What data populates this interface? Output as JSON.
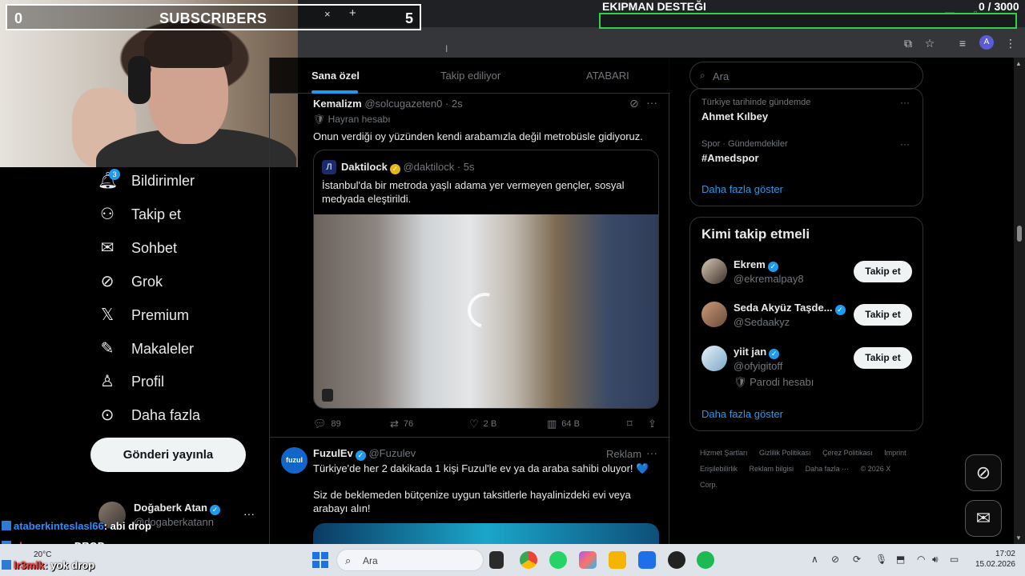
{
  "overlay": {
    "subscribers": {
      "left_count": "0",
      "title": "SUBSCRIBERS",
      "right_count": "5"
    },
    "goal": {
      "title": "EKIPMAN DESTEĞI",
      "count": "0  / 3000",
      "progress": 0
    },
    "tab_close": "×",
    "tab_new": "+"
  },
  "nav": {
    "notif_count": "3",
    "items": [
      {
        "label": "Bildirimler"
      },
      {
        "label": "Takip et"
      },
      {
        "label": "Sohbet"
      },
      {
        "label": "Grok"
      },
      {
        "label": "Premium"
      },
      {
        "label": "Makaleler"
      },
      {
        "label": "Profil"
      },
      {
        "label": "Daha fazla"
      }
    ],
    "post_button": "Gönderi yayınla",
    "me": {
      "name": "Doğaberk Atan",
      "handle": "@dogaberkatann",
      "more": "···"
    }
  },
  "feed": {
    "tabs": [
      "Sana özel",
      "Takip ediliyor",
      "ATABARI"
    ],
    "tweet1": {
      "author": "Kemalizm",
      "meta": "@solcugazeten0 · 2s",
      "label": "Hayran hesabı",
      "text": "Onun verdiği oy yüzünden kendi arabamızla değil metrobüsle gidiyoruz.",
      "quote": {
        "avatar_letter": "Л",
        "author": "Daktilock",
        "meta": "@daktilock · 5s",
        "text": "İstanbul'da bir metroda yaşlı adama yer vermeyen gençler, sosyal medyada eleştirildi."
      },
      "actions": {
        "replies": "89",
        "retweets": "76",
        "likes": "2 B",
        "views": "64 B"
      }
    },
    "tweet2": {
      "avatar_text": "fuzul",
      "author": "FuzulEv",
      "meta": "@Fuzulev",
      "ad_label": "Reklam",
      "text1": "Türkiye'de her 2 dakikada 1 kişi Fuzul'le ev ya da araba sahibi oluyor! 💙",
      "text2": "Siz de beklemeden bütçenize uygun taksitlerle hayalinizdeki evi veya arabayı alın!"
    }
  },
  "sidebar": {
    "search_placeholder": "Ara",
    "trends": [
      {
        "category": "Türkiye tarihinde gündemde",
        "name": "Ahmet Kılbey"
      },
      {
        "category": "Spor · Gündemdekiler",
        "name": "#Amedspor"
      }
    ],
    "show_more": "Daha fazla göster",
    "who_to_follow": {
      "title": "Kimi takip etmeli",
      "users": [
        {
          "name": "Ekrem",
          "handle": "@ekremalpay8",
          "button": "Takip et"
        },
        {
          "name": "Seda Akyüz Taşde...",
          "handle": "@Sedaakyz",
          "button": "Takip et"
        },
        {
          "name": "yiit jan",
          "handle": "@ofyigitoff",
          "note": "Parodi hesabı",
          "button": "Takip et"
        }
      ],
      "show_more": "Daha fazla göster"
    },
    "footer": [
      "Hizmet Şartları",
      "Gizlilik Politikası",
      "Çerez Politikası",
      "Imprint",
      "Erişilebilirlik",
      "Reklam bilgisi",
      "Daha fazla ···",
      "© 2026 X Corp."
    ]
  },
  "chat": [
    {
      "user": "ataberkinteslasl66",
      "msg": ": abi drop"
    },
    {
      "user": "alperenozs",
      "msg": ": DROP"
    },
    {
      "user": "lr3mlk",
      "msg": ": yok drop"
    }
  ],
  "taskbar": {
    "weather": "20°C",
    "search_placeholder": "Ara",
    "time": "17:02",
    "date": "15.02.2026"
  },
  "colors": {
    "accent": "#1d9bf0",
    "goal": "#2fd14a",
    "background": "#000000"
  }
}
